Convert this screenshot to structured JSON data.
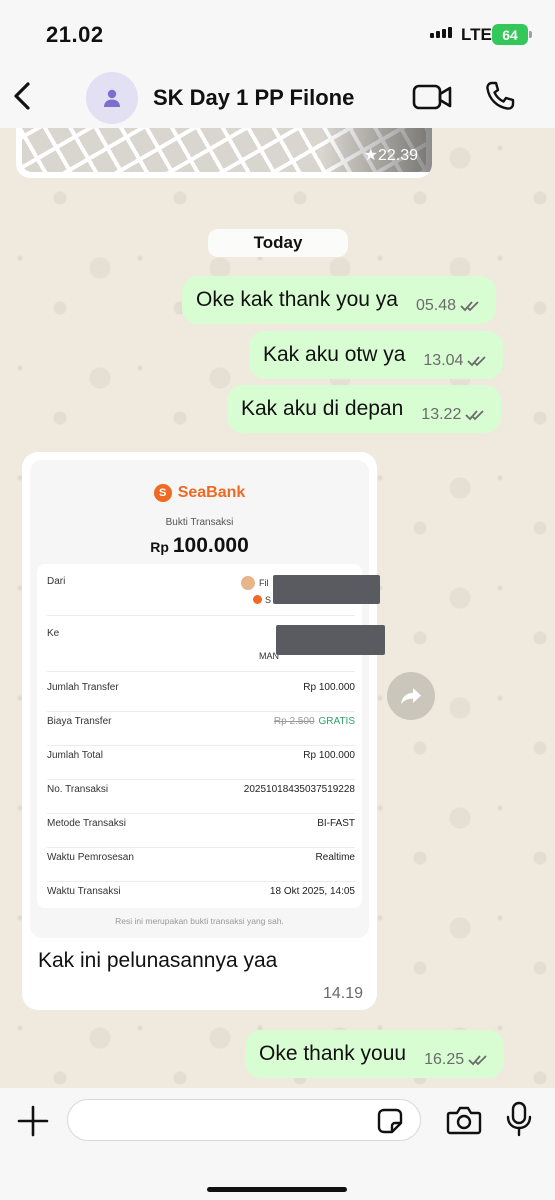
{
  "status_bar": {
    "time": "21.02",
    "network": "LTE",
    "battery": "64"
  },
  "header": {
    "title": "SK Day 1 PP Filone",
    "icons": {
      "back": "chevron-left-icon",
      "avatar": "person-icon",
      "video": "video-camera-icon",
      "call": "phone-icon"
    }
  },
  "map_preview": {
    "time": "22.39",
    "icon": "star-icon"
  },
  "date_separator": "Today",
  "messages": [
    {
      "text": "Oke kak thank you ya",
      "time": "05.48",
      "status": "read"
    },
    {
      "text": "Kak aku otw ya",
      "time": "13.04",
      "status": "read"
    },
    {
      "text": "Kak aku di depan",
      "time": "13.22",
      "status": "read"
    },
    {
      "text": "Oke thank youu",
      "time": "16.25",
      "status": "read"
    }
  ],
  "image_message": {
    "caption": "Kak ini pelunasannya yaa",
    "time": "14.19",
    "receipt": {
      "brand": "SeaBank",
      "brand_mark": "S",
      "subtitle": "Bukti Transaksi",
      "currency": "Rp",
      "amount": "100.000",
      "from_label": "Dari",
      "from_name_partial": "Fil",
      "from_bank_partial": "S",
      "to_label": "Ke",
      "to_bank_partial": "MAN",
      "rows": [
        {
          "key": "Jumlah Transfer",
          "value": "Rp 100.000"
        },
        {
          "key": "Biaya Transfer",
          "value_strike": "Rp 2.500",
          "value": "GRATIS"
        },
        {
          "key": "Jumlah Total",
          "value": "Rp 100.000"
        },
        {
          "key": "No. Transaksi",
          "value": "20251018435037519228"
        },
        {
          "key": "Metode Transaksi",
          "value": "BI-FAST"
        },
        {
          "key": "Waktu Pemrosesan",
          "value": "Realtime"
        },
        {
          "key": "Waktu Transaksi",
          "value": "18 Okt 2025, 14:05"
        }
      ],
      "footer": "Resi ini merupakan bukti transaksi yang sah."
    }
  },
  "input_bar": {
    "placeholder": "",
    "icons": {
      "attach": "plus-icon",
      "sticker": "sticker-icon",
      "camera": "camera-icon",
      "mic": "microphone-icon"
    }
  },
  "colors": {
    "outgoing_bubble": "#d9fdd3",
    "incoming_bubble": "#ffffff",
    "wallpaper": "#efe9de",
    "seabank_orange": "#ef6a22",
    "battery_green": "#34c759"
  }
}
